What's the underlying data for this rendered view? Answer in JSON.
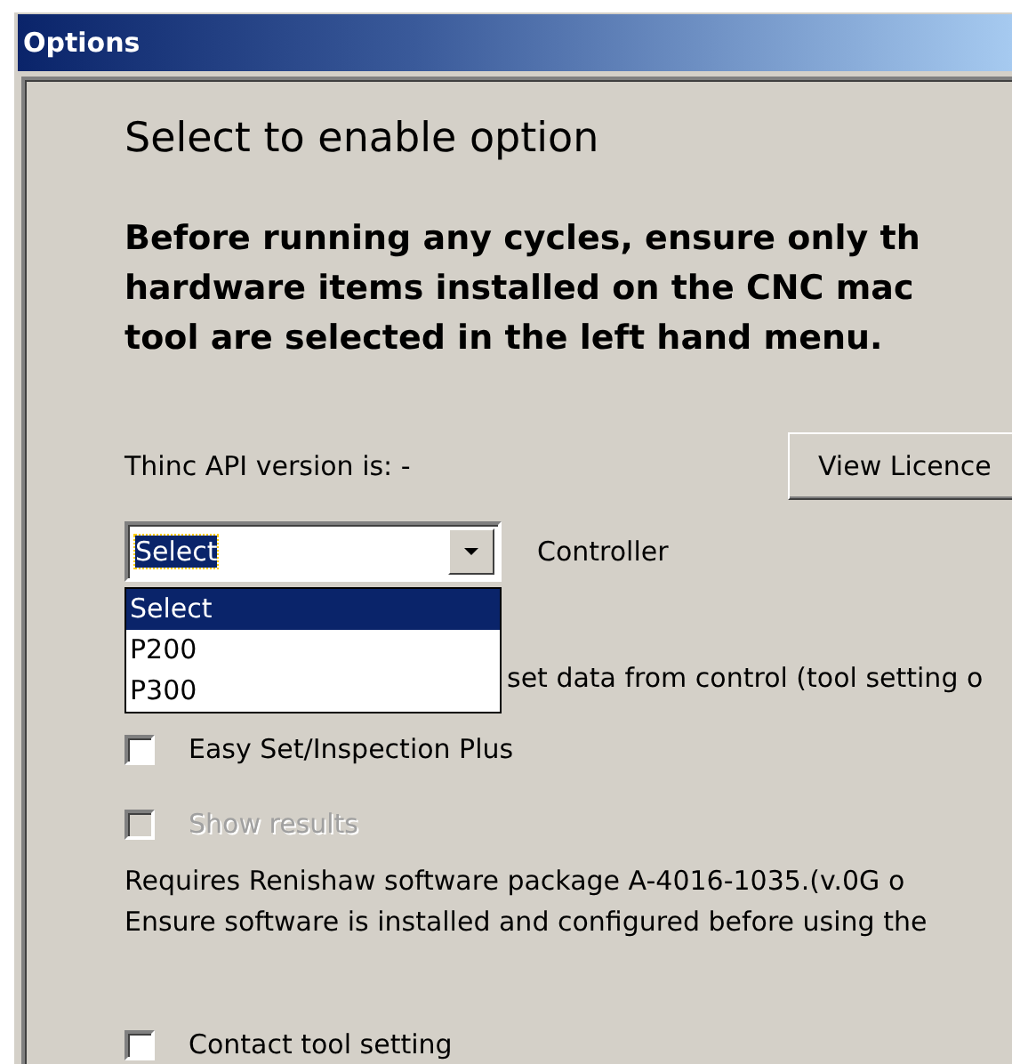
{
  "window": {
    "title": "Options"
  },
  "heading": "Select to enable option",
  "warning": "Before running any cycles, ensure only th\nhardware items installed on the CNC mac\ntool are selected in the left hand menu.",
  "api_version": "Thinc API version is: -",
  "licence_button": "View Licence",
  "controller": {
    "value": "Select",
    "label": "Controller",
    "expanded": true,
    "options": [
      {
        "label": "Select",
        "selected": true
      },
      {
        "label": "P200",
        "selected": false
      },
      {
        "label": "P300",
        "selected": false
      }
    ]
  },
  "options": [
    {
      "kind": "partial",
      "label": "set data from control (tool setting o"
    },
    {
      "kind": "checkbox",
      "label": "Easy Set/Inspection Plus",
      "checked": false,
      "disabled": false
    },
    {
      "kind": "checkbox",
      "label": "Show results",
      "checked": false,
      "disabled": true
    },
    {
      "kind": "note",
      "lines": [
        "Requires Renishaw software package A-4016-1035.(v.0G o",
        "Ensure software is installed and configured before using the"
      ]
    },
    {
      "kind": "checkbox",
      "label": "Contact tool setting",
      "checked": false,
      "disabled": false
    }
  ]
}
